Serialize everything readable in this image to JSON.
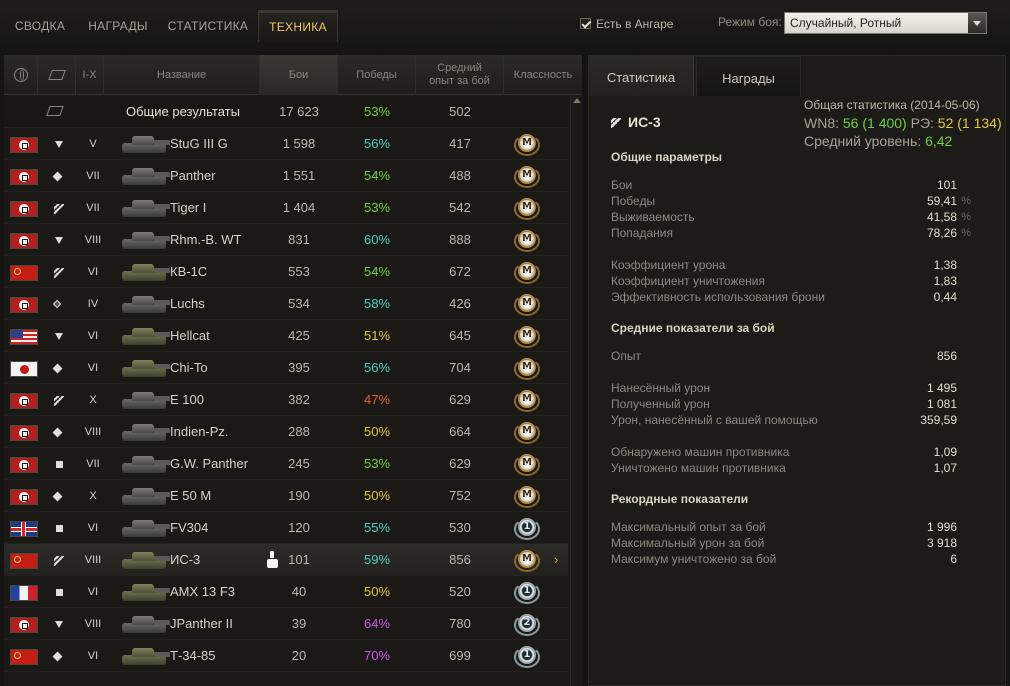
{
  "tabs": [
    "СВОДКА",
    "НАГРАДЫ",
    "СТАТИСТИКА",
    "ТЕХНИКА"
  ],
  "hangar_label": "Есть в Ангаре",
  "mode_label": "Режим боя:",
  "mode_value": "Случайный, Ротный",
  "columns": {
    "tier": "I-X",
    "name": "Название",
    "battles": "Бои",
    "wins": "Победы",
    "avg_xp_line1": "Средний",
    "avg_xp_line2": "опыт за бой",
    "mastery": "Классность"
  },
  "summary": {
    "name": "Общие результаты",
    "battles": "17 623",
    "wins": "53%",
    "xp": "502",
    "wins_color": "#6fd140"
  },
  "rows": [
    {
      "nation": "de",
      "type": "td",
      "tier": "V",
      "name": "StuG III G",
      "battles": "1 598",
      "wins": "56%",
      "wins_color": "#4fd0c0",
      "xp": "417",
      "mastery": "M",
      "tank": "grey"
    },
    {
      "nation": "de",
      "type": "mt",
      "tier": "VII",
      "name": "Panther",
      "battles": "1 551",
      "wins": "54%",
      "wins_color": "#6fd140",
      "xp": "488",
      "mastery": "M",
      "tank": "grey"
    },
    {
      "nation": "de",
      "type": "ht",
      "tier": "VII",
      "name": "Tiger I",
      "battles": "1 404",
      "wins": "53%",
      "wins_color": "#6fd140",
      "xp": "542",
      "mastery": "M",
      "tank": "grey"
    },
    {
      "nation": "de",
      "type": "td",
      "tier": "VIII",
      "name": "Rhm.-B. WT",
      "battles": "831",
      "wins": "60%",
      "wins_color": "#4fd0c0",
      "xp": "888",
      "mastery": "M",
      "tank": "grey"
    },
    {
      "nation": "ussr",
      "type": "ht",
      "tier": "VI",
      "name": "КВ-1С",
      "battles": "553",
      "wins": "54%",
      "wins_color": "#6fd140",
      "xp": "672",
      "mastery": "M",
      "tank": "green"
    },
    {
      "nation": "de",
      "type": "lt",
      "tier": "IV",
      "name": "Luchs",
      "battles": "534",
      "wins": "58%",
      "wins_color": "#4fd0c0",
      "xp": "426",
      "mastery": "M",
      "tank": "grey"
    },
    {
      "nation": "usa",
      "type": "td",
      "tier": "VI",
      "name": "Hellcat",
      "battles": "425",
      "wins": "51%",
      "wins_color": "#e6c93a",
      "xp": "645",
      "mastery": "M",
      "tank": "green"
    },
    {
      "nation": "jp",
      "type": "mt",
      "tier": "VI",
      "name": "Chi-To",
      "battles": "395",
      "wins": "56%",
      "wins_color": "#4fd0c0",
      "xp": "704",
      "mastery": "M",
      "tank": "green"
    },
    {
      "nation": "de",
      "type": "ht",
      "tier": "X",
      "name": "E 100",
      "battles": "382",
      "wins": "47%",
      "wins_color": "#e0603a",
      "xp": "629",
      "mastery": "M",
      "tank": "grey"
    },
    {
      "nation": "de",
      "type": "mt",
      "tier": "VIII",
      "name": "Indien-Pz.",
      "battles": "288",
      "wins": "50%",
      "wins_color": "#e6c93a",
      "xp": "664",
      "mastery": "M",
      "tank": "grey"
    },
    {
      "nation": "de",
      "type": "spg",
      "tier": "VII",
      "name": "G.W. Panther",
      "battles": "245",
      "wins": "53%",
      "wins_color": "#6fd140",
      "xp": "629",
      "mastery": "M",
      "tank": "grey"
    },
    {
      "nation": "de",
      "type": "mt",
      "tier": "X",
      "name": "E 50 M",
      "battles": "190",
      "wins": "50%",
      "wins_color": "#e6c93a",
      "xp": "752",
      "mastery": "M",
      "tank": "grey"
    },
    {
      "nation": "uk",
      "type": "spg",
      "tier": "VI",
      "name": "FV304",
      "battles": "120",
      "wins": "55%",
      "wins_color": "#4fd0c0",
      "xp": "530",
      "mastery": "1",
      "tank": "grey"
    },
    {
      "nation": "ussr",
      "type": "ht",
      "tier": "VIII",
      "name": "ИС-3",
      "battles": "101",
      "wins": "59%",
      "wins_color": "#4fd0c0",
      "xp": "856",
      "mastery": "M",
      "tank": "green",
      "selected": true
    },
    {
      "nation": "fr",
      "type": "spg",
      "tier": "VI",
      "name": "AMX 13 F3",
      "battles": "40",
      "wins": "50%",
      "wins_color": "#e6c93a",
      "xp": "520",
      "mastery": "1",
      "tank": "green"
    },
    {
      "nation": "de",
      "type": "td",
      "tier": "VIII",
      "name": "JPanther II",
      "battles": "39",
      "wins": "64%",
      "wins_color": "#c65ae6",
      "xp": "780",
      "mastery": "2",
      "tank": "grey"
    },
    {
      "nation": "ussr",
      "type": "mt",
      "tier": "VI",
      "name": "Т-34-85",
      "battles": "20",
      "wins": "70%",
      "wins_color": "#c65ae6",
      "xp": "699",
      "mastery": "1",
      "tank": "green"
    }
  ],
  "right": {
    "tabs": [
      "Статистика",
      "Награды"
    ],
    "overall_label": "Общая статистика (2014-05-06)",
    "wn8_label": "WN8:",
    "wn8_value": "56",
    "wn8_extra": "(1 400)",
    "re_label": "РЭ:",
    "re_value": "52",
    "re_extra": "(1 134)",
    "avg_level_label": "Средний уровень:",
    "avg_level_value": "6,42",
    "vehicle": "ИС-3",
    "sections": {
      "general": "Общие параметры",
      "average": "Средние показатели за бой",
      "records": "Рекордные показатели"
    },
    "stats": [
      {
        "label": "Бои",
        "value": "101",
        "pct": ""
      },
      {
        "label": "Победы",
        "value": "59,41",
        "pct": "%"
      },
      {
        "label": "Выживаемость",
        "value": "41,58",
        "pct": "%"
      },
      {
        "label": "Попадания",
        "value": "78,26",
        "pct": "%"
      },
      {
        "label": "Коэффициент урона",
        "value": "1,38",
        "pct": ""
      },
      {
        "label": "Коэффициент уничтожения",
        "value": "1,83",
        "pct": ""
      },
      {
        "label": "Эффективность использования брони",
        "value": "0,44",
        "pct": ""
      },
      {
        "label": "Опыт",
        "value": "856",
        "pct": ""
      },
      {
        "label": "Нанесённый урон",
        "value": "1 495",
        "pct": ""
      },
      {
        "label": "Полученный урон",
        "value": "1 081",
        "pct": ""
      },
      {
        "label": "Урон, нанесённый с вашей помощью",
        "value": "359,59",
        "pct": ""
      },
      {
        "label": "Обнаружено машин противника",
        "value": "1,09",
        "pct": ""
      },
      {
        "label": "Уничтожено машин противника",
        "value": "1,07",
        "pct": ""
      },
      {
        "label": "Максимальный опыт за бой",
        "value": "1 996",
        "pct": ""
      },
      {
        "label": "Максимальный урон за бой",
        "value": "3 918",
        "pct": ""
      },
      {
        "label": "Максимум уничтожено за бой",
        "value": "6",
        "pct": ""
      }
    ]
  }
}
